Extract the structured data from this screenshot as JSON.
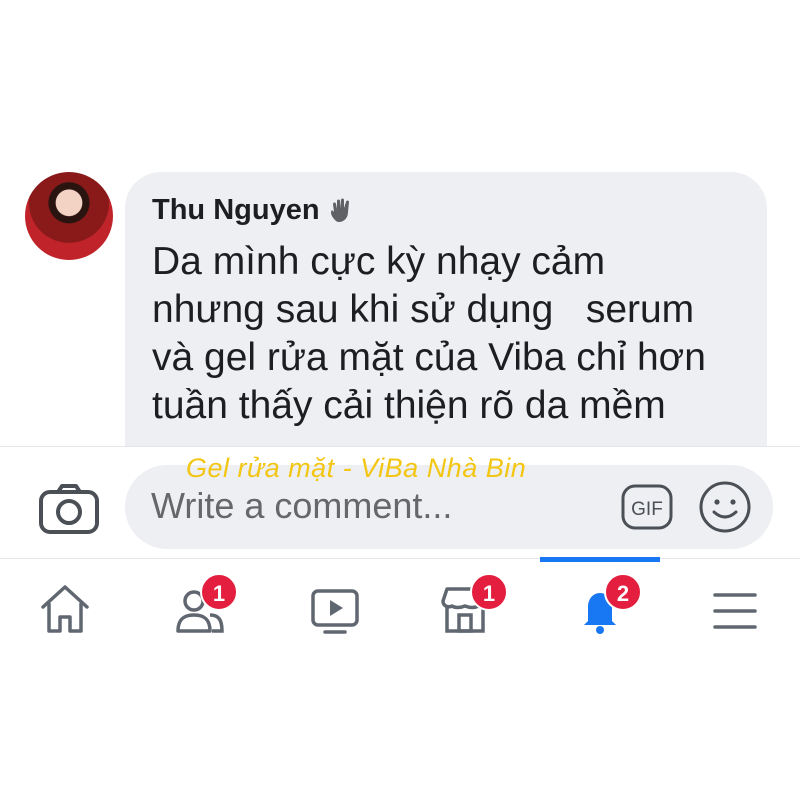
{
  "comment": {
    "author": "Thu Nguyen",
    "author_icon": "wave-hand-icon",
    "text": "Da mình cực kỳ nhạy cảm\nnhưng sau khi sử dụng   serum\nvà gel rửa mặt của Viba chỉ hơn\ntuần thấy cải thiện rõ da mềm"
  },
  "composer": {
    "placeholder": "Write a comment...",
    "gif_label": "GIF"
  },
  "watermark": "Gel rửa mặt - ViBa Nhà Bin",
  "nav": {
    "items": [
      {
        "icon": "home-icon",
        "badge": ""
      },
      {
        "icon": "friends-icon",
        "badge": "1"
      },
      {
        "icon": "watch-icon",
        "badge": ""
      },
      {
        "icon": "marketplace-icon",
        "badge": "1"
      },
      {
        "icon": "notifications-bell-icon",
        "badge": "2",
        "active": true
      },
      {
        "icon": "menu-icon",
        "badge": ""
      }
    ]
  },
  "colors": {
    "accent": "#1877f2",
    "badge": "#e41e3f",
    "bubble": "#eeeff3",
    "watermark": "#f2c613"
  }
}
